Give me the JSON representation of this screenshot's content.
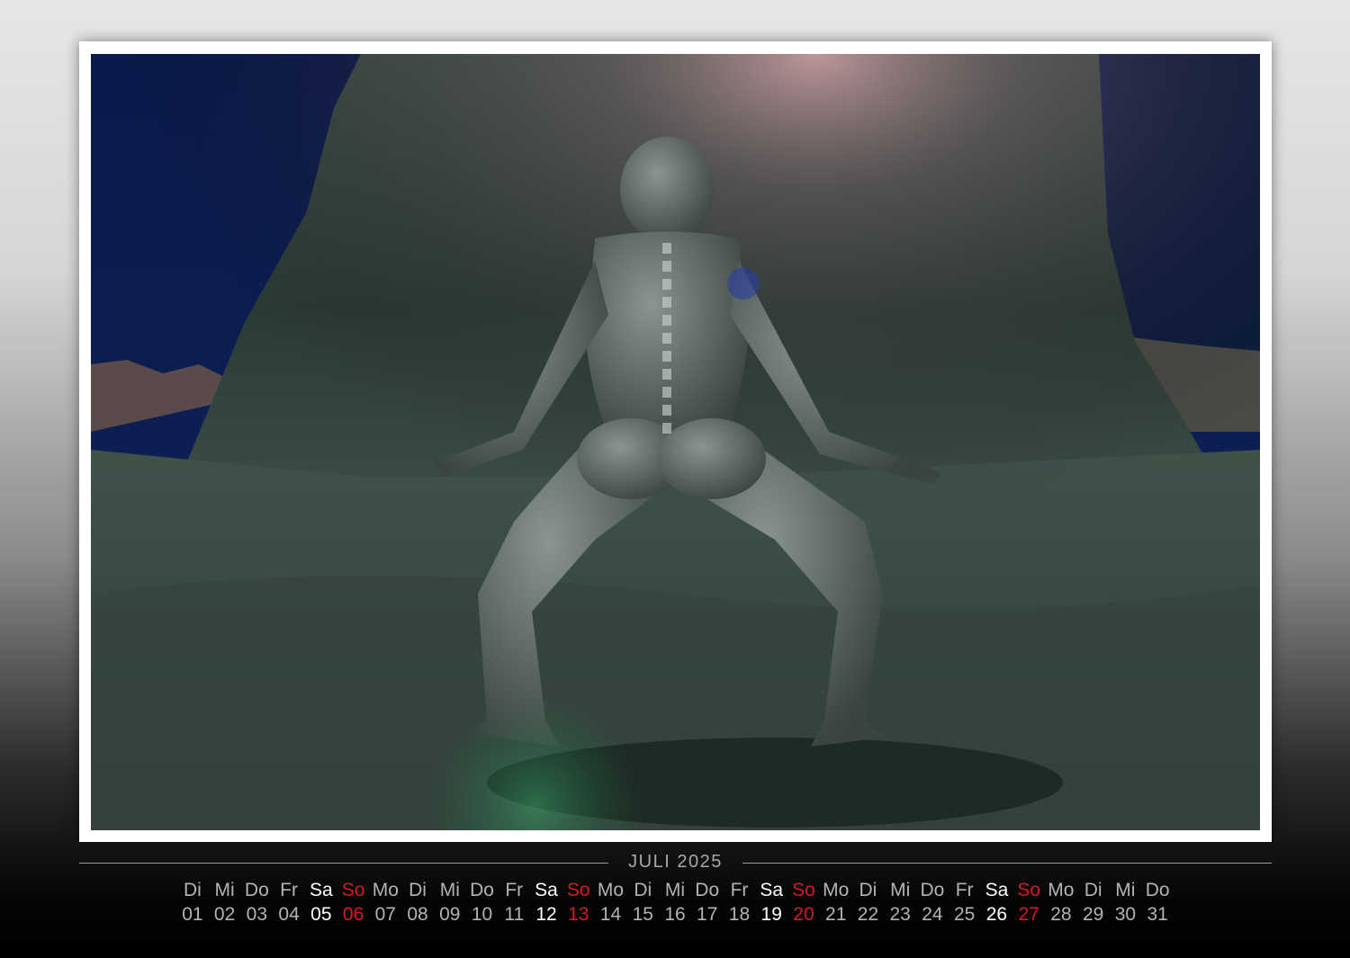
{
  "calendar": {
    "month_label": "JULI 2025",
    "weekdays": [
      "Di",
      "Mi",
      "Do",
      "Fr",
      "Sa",
      "So",
      "Mo",
      "Di",
      "Mi",
      "Do",
      "Fr",
      "Sa",
      "So",
      "Mo",
      "Di",
      "Mi",
      "Do",
      "Fr",
      "Sa",
      "So",
      "Mo",
      "Di",
      "Mi",
      "Do",
      "Fr",
      "Sa",
      "So",
      "Mo",
      "Di",
      "Mi",
      "Do"
    ],
    "dates": [
      "01",
      "02",
      "03",
      "04",
      "05",
      "06",
      "07",
      "08",
      "09",
      "10",
      "11",
      "12",
      "13",
      "14",
      "15",
      "16",
      "17",
      "18",
      "19",
      "20",
      "21",
      "22",
      "23",
      "24",
      "25",
      "26",
      "27",
      "28",
      "29",
      "30",
      "31"
    ],
    "day_types": [
      "w",
      "w",
      "w",
      "w",
      "sat",
      "sun",
      "w",
      "w",
      "w",
      "w",
      "w",
      "sat",
      "sun",
      "w",
      "w",
      "w",
      "w",
      "w",
      "sat",
      "sun",
      "w",
      "w",
      "w",
      "w",
      "w",
      "sat",
      "sun",
      "w",
      "w",
      "w",
      "w"
    ]
  },
  "colors": {
    "weekday_text": "#b3b3b3",
    "saturday_text": "#ffffff",
    "sunday_text": "#d21b22",
    "frame": "#ffffff"
  }
}
